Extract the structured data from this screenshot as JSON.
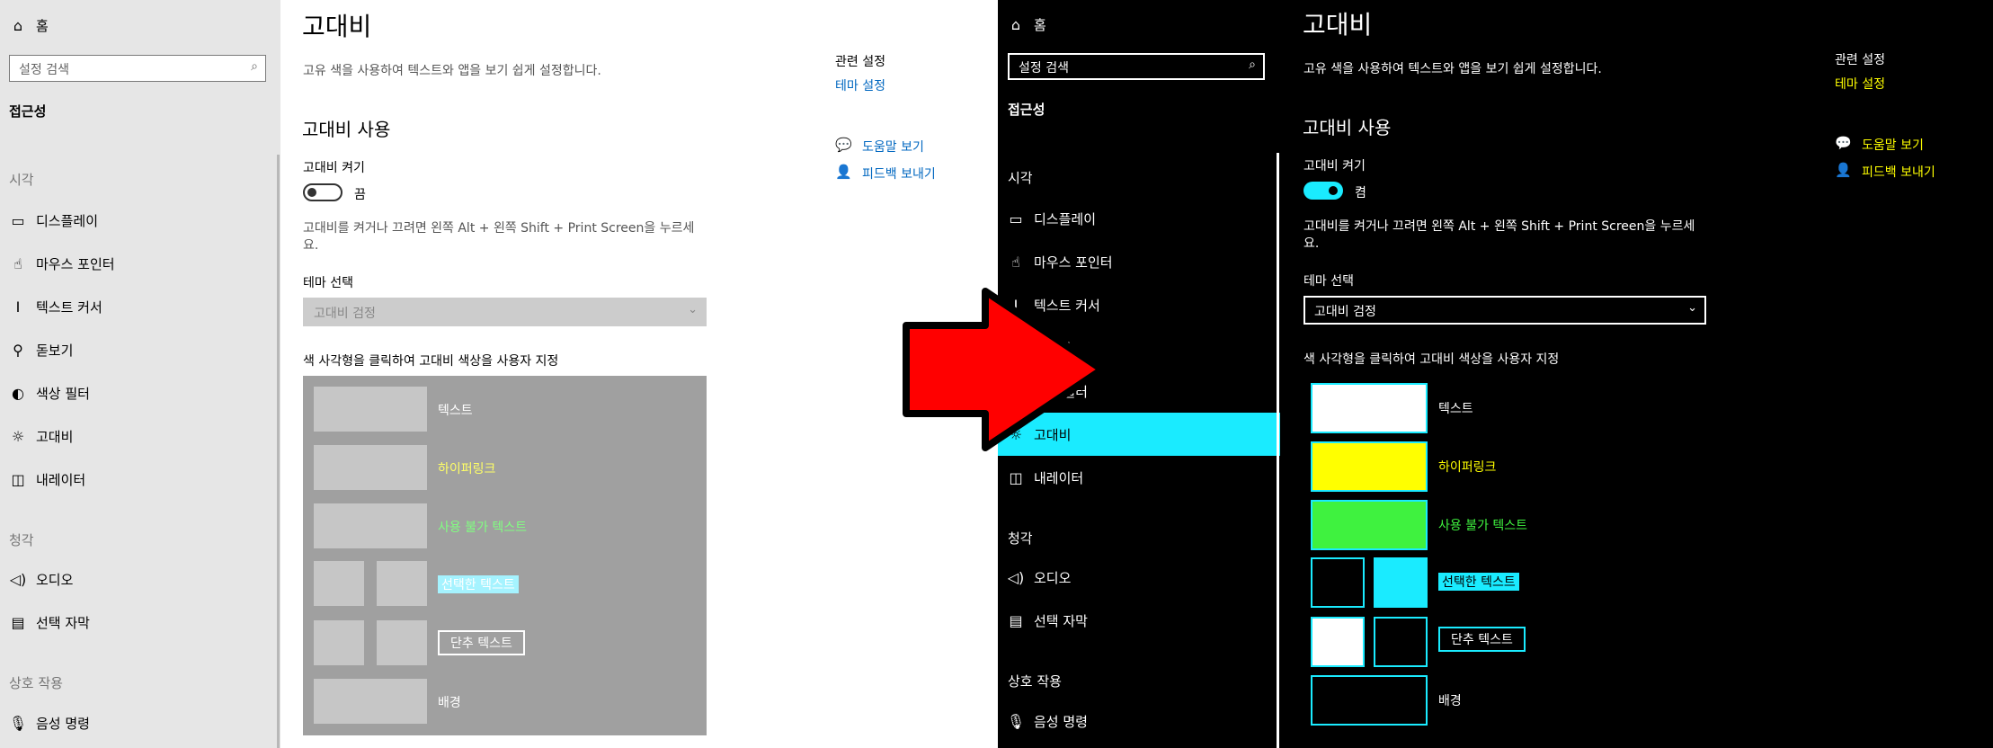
{
  "nav": {
    "home": "홈",
    "search_placeholder": "설정 검색",
    "category": "접근성",
    "section_vision": "시각",
    "section_hearing": "청각",
    "section_interaction": "상호 작용",
    "items": {
      "display": "디스플레이",
      "mouse_pointer": "마우스 포인터",
      "text_cursor": "텍스트 커서",
      "magnifier": "돋보기",
      "color_filter": "색상 필터",
      "high_contrast": "고대비",
      "narrator": "내레이터",
      "audio": "오디오",
      "captions": "선택 자막",
      "speech": "음성 명령"
    }
  },
  "left": {
    "page_title": "고대비",
    "description": "고유 색을 사용하여 텍스트와 앱을 보기 쉽게 설정합니다.",
    "section_title": "고대비 사용",
    "toggle_label": "고대비 켜기",
    "toggle_state": "끔",
    "shortcut_line1": "고대비를 켜거나 끄려면 왼쪽 Alt + 왼쪽 Shift + Print Screen을 누르세",
    "shortcut_line2": "요.",
    "theme_label": "테마 선택",
    "theme_value": "고대비 검정",
    "customize_hint": "색 사각형을 클릭하여 고대비 색상을 사용자 지정",
    "swatch_labels": {
      "text": "텍스트",
      "hyperlink": "하이퍼링크",
      "disabled": "사용 불가 텍스트",
      "selected": "선택한 텍스트",
      "button": "단추 텍스트",
      "background": "배경"
    },
    "related_title": "관련 설정",
    "related_link": "테마 설정",
    "help_link": "도움말 보기",
    "feedback_link": "피드백 보내기",
    "colors": {
      "hyperlink": "#ffff66",
      "disabled": "#80ff80",
      "selected_bg": "#a5f3ff",
      "panel": "#a0a0a0",
      "link": "#0067c0"
    }
  },
  "right": {
    "page_title": "고대비",
    "description": "고유 색을 사용하여 텍스트와 앱을 보기 쉽게 설정합니다.",
    "section_title": "고대비 사용",
    "toggle_label": "고대비 켜기",
    "toggle_state": "켬",
    "shortcut_line1": "고대비를 켜거나 끄려면 왼쪽 Alt + 왼쪽 Shift + Print Screen을 누르세",
    "shortcut_line2": "요.",
    "theme_label": "테마 선택",
    "theme_value": "고대비 검정",
    "customize_hint": "색 사각형을 클릭하여 고대비 색상을 사용자 지정",
    "swatch_labels": {
      "text": "텍스트",
      "hyperlink": "하이퍼링크",
      "disabled": "사용 불가 텍스트",
      "selected": "선택한 텍스트",
      "button": "단추 텍스트",
      "background": "배경"
    },
    "related_title": "관련 설정",
    "related_link": "테마 설정",
    "help_link": "도움말 보기",
    "feedback_link": "피드백 보내기",
    "colors": {
      "accent": "#1aebff",
      "hyperlink": "#ffff00",
      "disabled": "#3ff23f",
      "text": "#ffffff"
    }
  },
  "arrow": {
    "color": "#ff0000",
    "icon": "right-arrow-icon"
  }
}
